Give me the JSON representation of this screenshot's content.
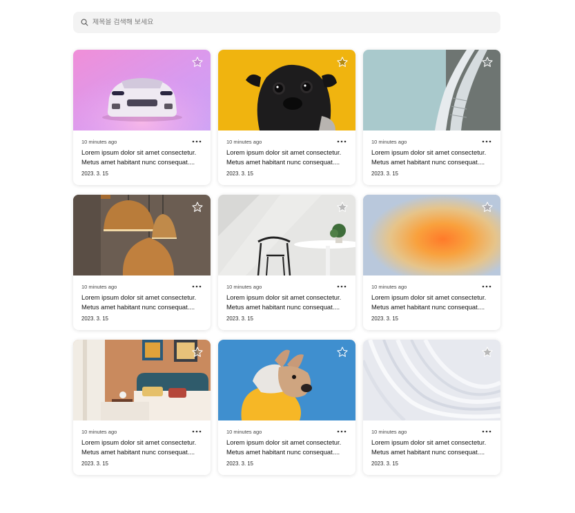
{
  "search": {
    "placeholder": "제목을 검색해 보세요",
    "icon": "search-icon"
  },
  "cards": [
    {
      "image": "pink sports car",
      "time": "10 minutes ago",
      "line1": "Lorem ipsum dolor sit amet consectetur.",
      "line2": "Metus amet habitant nunc consequat....",
      "date": "2023. 3. 15",
      "favorite": false
    },
    {
      "image": "pug on yellow background",
      "time": "10 minutes ago",
      "line1": "Lorem ipsum dolor sit amet consectetur.",
      "line2": "Metus amet habitant nunc consequat....",
      "date": "2023. 3. 15",
      "favorite": true
    },
    {
      "image": "curved architecture",
      "time": "10 minutes ago",
      "line1": "Lorem ipsum dolor sit amet consectetur.",
      "line2": "Metus amet habitant nunc consequat....",
      "date": "2023. 3. 15",
      "favorite": false
    },
    {
      "image": "copper pendant lamps",
      "time": "10 minutes ago",
      "line1": "Lorem ipsum dolor sit amet consectetur.",
      "line2": "Metus amet habitant nunc consequat....",
      "date": "2023. 3. 15",
      "favorite": false
    },
    {
      "image": "chair and table interior",
      "time": "10 minutes ago",
      "line1": "Lorem ipsum dolor sit amet consectetur.",
      "line2": "Metus amet habitant nunc consequat....",
      "date": "2023. 3. 15",
      "favorite": false
    },
    {
      "image": "orange gradient blur",
      "time": "10 minutes ago",
      "line1": "Lorem ipsum dolor sit amet consectetur.",
      "line2": "Metus amet habitant nunc consequat....",
      "date": "2023. 3. 15",
      "favorite": false
    },
    {
      "image": "bedroom interior",
      "time": "10 minutes ago",
      "line1": "Lorem ipsum dolor sit amet consectetur.",
      "line2": "Metus amet habitant nunc consequat....",
      "date": "2023. 3. 15",
      "favorite": false
    },
    {
      "image": "french bulldog in hoodie",
      "time": "10 minutes ago",
      "line1": "Lorem ipsum dolor sit amet consectetur.",
      "line2": "Metus amet habitant nunc consequat....",
      "date": "2023. 3. 15",
      "favorite": false
    },
    {
      "image": "white wavy lines",
      "time": "10 minutes ago",
      "line1": "Lorem ipsum dolor sit amet consectetur.",
      "line2": "Metus amet habitant nunc consequat....",
      "date": "2023. 3. 15",
      "favorite": false
    }
  ],
  "colors": {
    "search_bg": "#f3f3f3",
    "star_outline": "#ffffff",
    "star_fill_active": "#c9a227",
    "star_fill_inactive": "#b9b9b9"
  },
  "icons": {
    "favorite": "star-icon",
    "options": "more-options-icon"
  }
}
